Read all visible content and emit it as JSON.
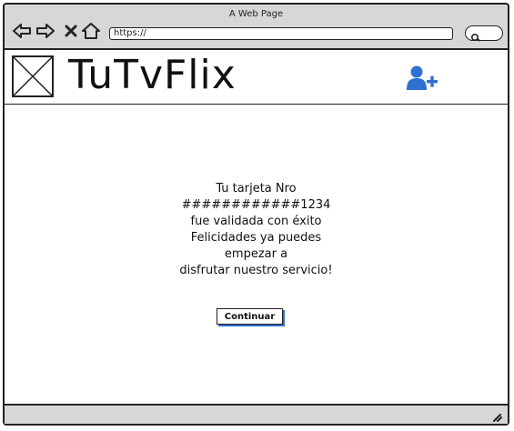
{
  "window": {
    "title": "A Web Page",
    "url": "https://"
  },
  "header": {
    "brand": "TuTvFlix"
  },
  "message": {
    "lines": [
      "Tu tarjeta Nro",
      "############1234",
      "fue validada con éxito",
      "Felicidades ya puedes",
      "empezar a",
      "disfrutar nuestro servicio!"
    ]
  },
  "actions": {
    "continue_label": "Continuar"
  },
  "icons": {
    "back": "arrow-left-icon",
    "forward": "arrow-right-icon",
    "stop": "close-icon",
    "home": "home-icon",
    "search": "search-icon",
    "logo": "image-placeholder-icon",
    "add_user": "user-plus-icon",
    "resize": "resize-grip-icon"
  },
  "colors": {
    "accent": "#2f6fd1",
    "chrome": "#d7d7d7"
  }
}
